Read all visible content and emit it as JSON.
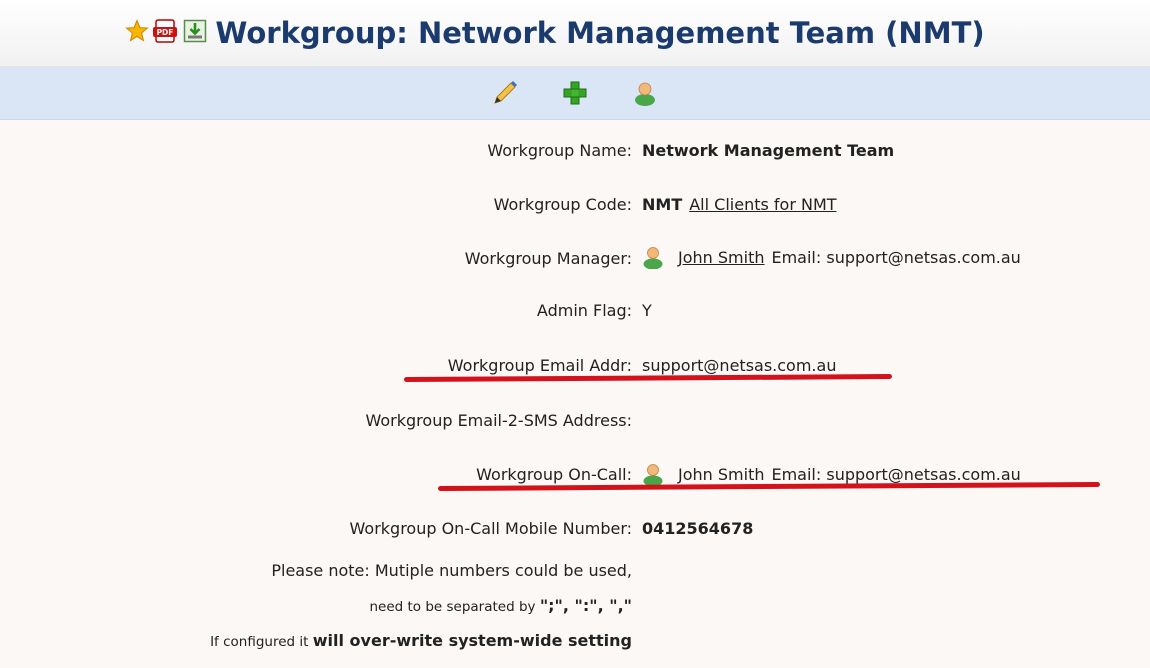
{
  "header": {
    "title": "Workgroup: Network Management Team (NMT)",
    "icons": [
      "star-icon",
      "pdf-icon",
      "export-icon"
    ]
  },
  "toolbar": {
    "icons": [
      "edit-pencil-icon",
      "add-plus-icon",
      "user-icon"
    ]
  },
  "fields": {
    "name": {
      "label": "Workgroup Name:",
      "value": "Network Management Team"
    },
    "code": {
      "label": "Workgroup Code:",
      "value": "NMT",
      "link": "All Clients for NMT"
    },
    "manager": {
      "label": "Workgroup Manager:",
      "name": "John Smith",
      "email": "Email: support@netsas.com.au"
    },
    "admin": {
      "label": "Admin Flag:",
      "value": "Y"
    },
    "email_addr": {
      "label": "Workgroup Email Addr:",
      "value": "support@netsas.com.au"
    },
    "sms_addr": {
      "label": "Workgroup Email-2-SMS Address:",
      "value": ""
    },
    "on_call": {
      "label": "Workgroup On-Call:",
      "name": "John Smith",
      "email": "Email: support@netsas.com.au"
    },
    "mobile": {
      "label": "Workgroup On-Call Mobile Number:",
      "value": "0412564678",
      "note1": "Please note: Mutiple numbers could be used,",
      "note2a": "need to be separated by ",
      "note2b": "\";\", \":\", \",\"",
      "note3a": "If configured it ",
      "note3b": "will over-write system-wide setting"
    }
  },
  "colors": {
    "title": "#1b3a6e",
    "toolbar_bg": "#dae6f5",
    "row_bg": "#fbf8f5",
    "highlight_underline": "#d4121c"
  }
}
